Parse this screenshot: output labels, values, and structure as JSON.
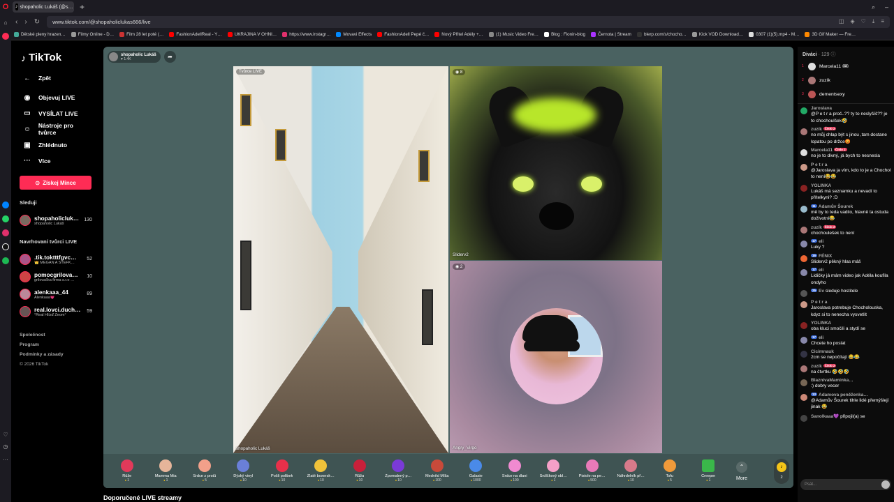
{
  "browser": {
    "tab_title": "shopaholic Lukáš (@s…",
    "url": "www.tiktok.com/@shopaholiclukas666/live",
    "bookmarks": [
      "Dětské pleny hrazen…",
      "Filmy Online - D…",
      "Film 28 let poté (…",
      "FashionAdellReal - Y…",
      "UKRAJINA V OHNI…",
      "https://www.instagr…",
      "Movavi Effects",
      "FashionAdell Pepé č…",
      "Nový Přítel Adély +…",
      "(1) Music Video Fre…",
      "Blog : Fionin-blog",
      "Černota | Stream",
      "blerp.com/s/chocho…",
      "Kick VOD Download…",
      "0307 (1)(5).mp4 - M…",
      "3D Gif Maker — Fre…"
    ]
  },
  "sidebar": {
    "logo": "TikTok",
    "back_label": "Zpět",
    "nav": [
      {
        "label": "Objevuj LIVE",
        "icon": "live-discover-icon"
      },
      {
        "label": "VYSÍLAT LIVE",
        "icon": "camera-icon"
      },
      {
        "label": "Nástroje pro tvůrce",
        "icon": "person-tools-icon"
      },
      {
        "label": "Zhlédnuto",
        "icon": "history-icon"
      },
      {
        "label": "Více",
        "icon": "more-dots-icon"
      }
    ],
    "coin_button": "Získej Mince",
    "following_title": "Sleduji",
    "following": [
      {
        "name": "shopaholicluk…",
        "sub": "shopaholic Lukáš",
        "count": "130"
      }
    ],
    "suggested_title": "Navrhovaní tvůrci LIVE",
    "suggested": [
      {
        "name": ".tik.toktttfgvc…",
        "sub": "👑 MEGAN A ŠTEFK…",
        "count": "52"
      },
      {
        "name": "pomocgrilova…",
        "sub": "grilovačka firma s.r.o …",
        "count": "10"
      },
      {
        "name": "alenkaaa_44",
        "sub": "Alenkaaa💗",
        "count": "89"
      },
      {
        "name": "real.lovci.duch…",
        "sub": "°Real Hlízď Zeom°",
        "count": "59"
      }
    ],
    "footer": [
      "Společnost",
      "Program",
      "Podmínky a zásady",
      "© 2026 TikTok"
    ]
  },
  "stage": {
    "host_name": "shopaholic Lukáš",
    "host_likes": "♥ 1.4K",
    "panes": {
      "street_label": "Tvůrce LIVE",
      "street_name": "shopaholic Lukáš",
      "furry_badge": "8",
      "furry_name": "Sliderv2",
      "person_badge": "2",
      "person_name": "Angry_Virgo"
    }
  },
  "gifts": [
    {
      "name": "Růže",
      "price": "1"
    },
    {
      "name": "Mamma Mia",
      "price": "1"
    },
    {
      "name": "Srdce z prstů",
      "price": "5"
    },
    {
      "name": "Dýský vinyl",
      "price": "10"
    },
    {
      "name": "Pošli polibek",
      "price": "10"
    },
    {
      "name": "Zlaté boxersk…",
      "price": "10"
    },
    {
      "name": "Růža",
      "price": "10"
    },
    {
      "name": "Zpomalený p…",
      "price": "10"
    },
    {
      "name": "Medvěd Míša",
      "price": "100"
    },
    {
      "name": "Galaxie",
      "price": "1000"
    },
    {
      "name": "Srdce na dlani",
      "price": "100"
    },
    {
      "name": "Srdíčkový obl…",
      "price": "1"
    },
    {
      "name": "Pistole na pe…",
      "price": "500"
    },
    {
      "name": "Náhrdelník př…",
      "price": "10"
    },
    {
      "name": "Tofu",
      "price": "5"
    },
    {
      "name": "Creeper",
      "price": "1"
    }
  ],
  "gift_more": "More",
  "coin_count": "2",
  "recommended_title": "Doporučené LIVE streamy",
  "chat": {
    "viewers_label": "Diváci",
    "viewers_count": "· 129",
    "viewers": [
      {
        "rank": "1",
        "name": "Marcela11 🎟"
      },
      {
        "rank": "2",
        "name": "zuzík"
      },
      {
        "rank": "3",
        "name": "dementsexy"
      }
    ],
    "messages": [
      {
        "user": "Jaroslava",
        "badge": "",
        "text": "@P e t r a proč..?? ty to neslyšíš?? je to chochoulšek🤣"
      },
      {
        "user": "zuzík",
        "badge": "Číslo 2",
        "text": "no můj chlap být s jinou ,tam dostane lopatou po držce😡"
      },
      {
        "user": "Marcela11",
        "badge": "Číslo 2",
        "text": "no je to divný, já bych to nesnesla"
      },
      {
        "user": "P e t r a",
        "badge": "",
        "text": "@Jaroslava ja vím, kdo to je a Chochol to není😂😂"
      },
      {
        "user": "YOLINKA",
        "badge": "",
        "text": "Lukáš má seznamku a nevadí to přítelkyni? :D"
      },
      {
        "user": "Adamův Šourek",
        "badge": "11",
        "text": "mě by to teda vadilo, hlavně ta ostuda doživotní😂"
      },
      {
        "user": "zuzík",
        "badge": "Číslo 2",
        "text": "chochoulešek to není"
      },
      {
        "user": "eli",
        "badge": "17",
        "text": "Luky ?"
      },
      {
        "user": "FÉNIX",
        "badge": "16",
        "text": "Sliderv2 pěkný hlas máš"
      },
      {
        "user": "eli",
        "badge": "17",
        "text": "Lidičky já mám video jak Adéla koufila ondyho"
      },
      {
        "user": "Ev",
        "badge": "25",
        "text": "sleduje hostitele"
      },
      {
        "user": "P e t r a",
        "badge": "",
        "text": "Jaroslava potrebuje Chocholouska, kdyz si to nenecha vysvetlit"
      },
      {
        "user": "YOLINKA",
        "badge": "",
        "text": "oba kluci smočili a stydí se"
      },
      {
        "user": "eli",
        "badge": "17",
        "text": "Chcete ho poslat"
      },
      {
        "user": "Cicimnauk",
        "badge": "",
        "text": "2cm se nepočítají 😂😂"
      },
      {
        "user": "zuzík",
        "badge": "Číslo 2",
        "text": "na čtvrtku 🤣🤣🤣"
      },
      {
        "user": "BlaznivaMaminka…",
        "badge": "",
        "text": ":) dobry vecer"
      },
      {
        "user": "Adamova peněženka…",
        "badge": "13",
        "text": "@Adamův Šourek tihle lidé přemýšlejí jinak 😂"
      },
      {
        "user": "Sanolkaaa💜",
        "badge": "",
        "text": "připojil(a) se"
      }
    ],
    "input_placeholder": "Psát..."
  }
}
